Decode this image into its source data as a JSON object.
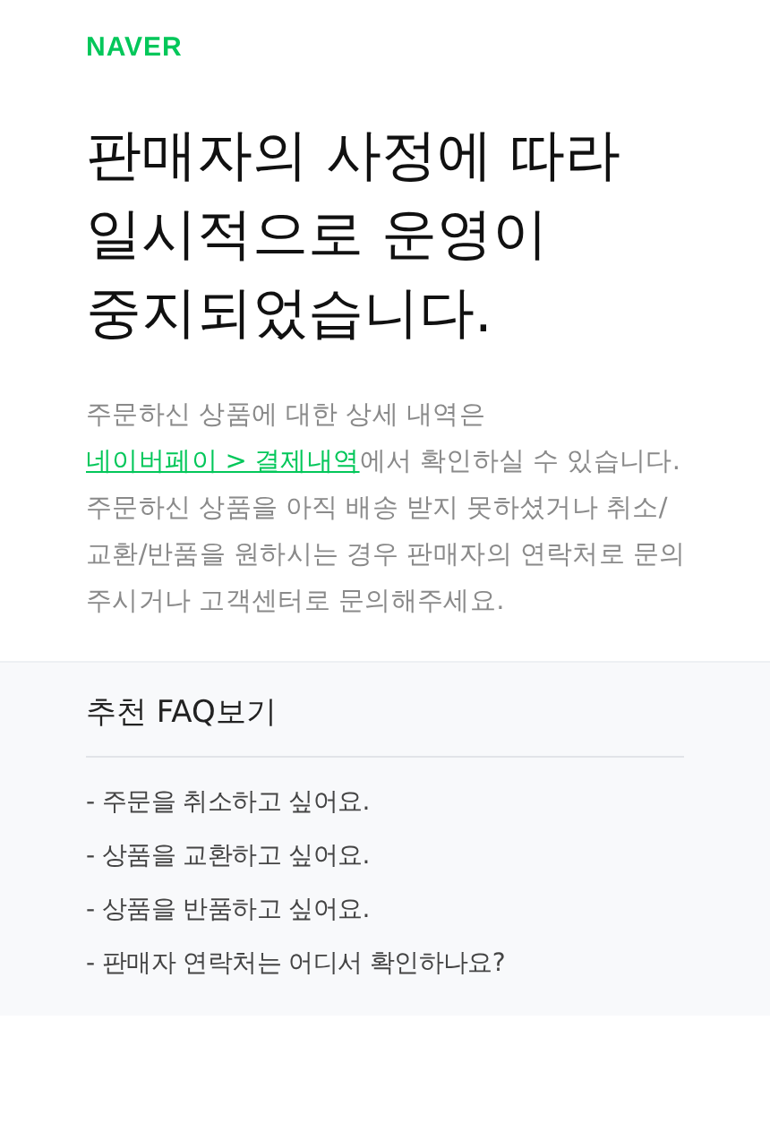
{
  "logo": "NAVER",
  "title": [
    "판매자의 사정에 따라",
    "일시적으로 운영이",
    "중지되었습니다."
  ],
  "notice": {
    "before": "주문하신 상품에 대한 상세 내역은 ",
    "link": "네이버페이 > 결제내역",
    "after": "에서 확인하실 수 있습니다."
  },
  "message": "주문하신 상품을 아직 배송 받지 못하셨거나 취소/교환/반품을 원하시는 경우 판매자의 연락처로 문의 주시거나 고객센터로 문의해주세요.",
  "faq": {
    "heading": "추천 FAQ보기",
    "items": [
      "- 주문을 취소하고 싶어요.",
      "- 상품을 교환하고 싶어요.",
      "- 상품을 반품하고 싶어요.",
      "- 판매자 연락처는 어디서 확인하나요?"
    ]
  }
}
